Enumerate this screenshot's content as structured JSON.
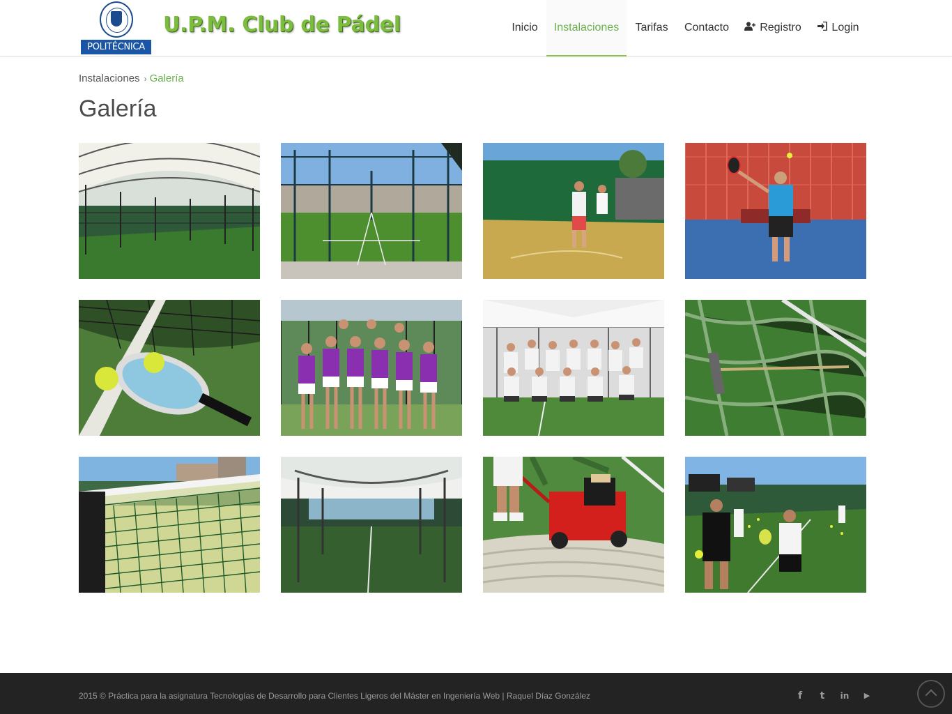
{
  "header": {
    "logo_text": "POLITÉCNICA",
    "site_title": "U.P.M. Club de Pádel",
    "brand_color": "#7cbd3f",
    "nav": [
      {
        "label": "Inicio",
        "active": false
      },
      {
        "label": "Instalaciones",
        "active": true
      },
      {
        "label": "Tarifas",
        "active": false
      },
      {
        "label": "Contacto",
        "active": false
      },
      {
        "label": "Registro",
        "icon": "add-user-icon",
        "active": false
      },
      {
        "label": "Login",
        "icon": "sign-in-icon",
        "active": false
      }
    ]
  },
  "breadcrumb": {
    "parent": "Instalaciones",
    "separator_icon": "chevron-right-icon",
    "current": "Galería"
  },
  "page_title": "Galería",
  "gallery": {
    "images": [
      {
        "subject": "covered padel courts under white canopy"
      },
      {
        "subject": "outdoor padel court with glass walls and blue sky"
      },
      {
        "subject": "two players on a court with green walls"
      },
      {
        "subject": "player hitting a ball on a blue court"
      },
      {
        "subject": "padel racket and two yellow balls on turf"
      },
      {
        "subject": "women's team in purple shirts"
      },
      {
        "subject": "men's team group photo under tent"
      },
      {
        "subject": "rake on green artificial grass"
      },
      {
        "subject": "padel net close-up with buildings behind"
      },
      {
        "subject": "covered court with green turf"
      },
      {
        "subject": "red turf grooming machine on court"
      },
      {
        "subject": "coaching session with players on court"
      }
    ]
  },
  "footer": {
    "text": "2015 © Práctica para la asignatura Tecnologías de Desarrollo para Clientes Ligeros del Máster en Ingeniería Web | Raquel Díaz González",
    "social": [
      {
        "icon": "facebook-icon",
        "glyph": "f"
      },
      {
        "icon": "twitter-icon",
        "glyph": "t"
      },
      {
        "icon": "linkedin-icon",
        "glyph": "in"
      },
      {
        "icon": "youtube-icon",
        "glyph": "▶"
      }
    ],
    "back_to_top_icon": "chevron-up-icon"
  }
}
